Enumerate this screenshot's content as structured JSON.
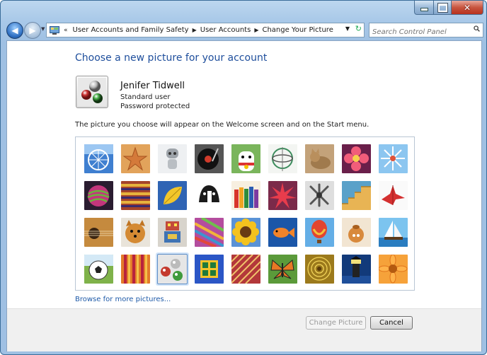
{
  "window": {
    "caption_buttons": [
      "minimize",
      "maximize",
      "close"
    ]
  },
  "nav": {
    "breadcrumb": [
      "User Accounts and Family Safety",
      "User Accounts",
      "Change Your Picture"
    ],
    "search_placeholder": "Search Control Panel"
  },
  "page": {
    "heading": "Choose a new picture for your account",
    "note": "The picture you choose will appear on the Welcome screen and on the Start menu.",
    "browse_link": "Browse for more pictures..."
  },
  "user": {
    "name": "Jenifer Tidwell",
    "type": "Standard user",
    "password_status": "Password protected",
    "picture": "marbles"
  },
  "pictures": [
    "ferris-wheel",
    "starfish",
    "robot",
    "turntable",
    "lucky-cat",
    "gyroscope",
    "kitten",
    "flower",
    "pinwheel",
    "striped-ball",
    "fabric",
    "leaf",
    "dog",
    "crayons",
    "red-star",
    "jacks",
    "stairs",
    "paper-crane",
    "guitar",
    "puppy",
    "toy-robot",
    "scarves",
    "sunflower",
    "fish",
    "hot-air-balloon",
    "teapot",
    "sailboat",
    "soccer-ball",
    "textile",
    "marbles",
    "window",
    "rug",
    "butterfly",
    "gold-flower",
    "lighthouse",
    "daisy"
  ],
  "selected_picture": "marbles",
  "buttons": {
    "change": "Change Picture",
    "cancel": "Cancel"
  },
  "colors": {
    "accent_heading": "#1e4e9c",
    "link": "#1e5aa8",
    "selection": "#5d8ec7"
  }
}
